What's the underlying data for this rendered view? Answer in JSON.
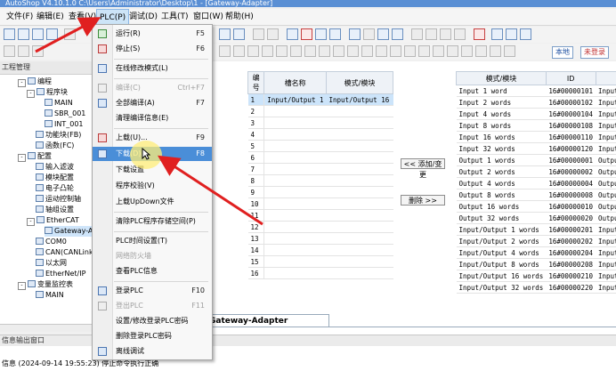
{
  "window": {
    "title": "AutoShop V4.10.1.0  C:\\Users\\Administrator\\Desktop\\1 - [Gateway-Adapter]"
  },
  "menubar": {
    "items": [
      {
        "label": "文件(F)"
      },
      {
        "label": "编辑(E)"
      },
      {
        "label": "查看(V)"
      },
      {
        "label": "PLC(P)"
      },
      {
        "label": "调试(D)"
      },
      {
        "label": "工具(T)"
      },
      {
        "label": "窗口(W)"
      },
      {
        "label": "帮助(H)"
      }
    ]
  },
  "toolbar": {
    "local_label": "本地",
    "login_status": "未登录"
  },
  "project_panel": {
    "title": "工程管理"
  },
  "tree": [
    {
      "label": "编程"
    },
    {
      "label": "程序块"
    },
    {
      "label": "MAIN"
    },
    {
      "label": "SBR_001"
    },
    {
      "label": "INT_001"
    },
    {
      "label": "功能块(FB)"
    },
    {
      "label": "函数(FC)"
    },
    {
      "label": "配置"
    },
    {
      "label": "输入滤波"
    },
    {
      "label": "模块配置"
    },
    {
      "label": "电子凸轮"
    },
    {
      "label": "运动控制轴"
    },
    {
      "label": "轴组设置"
    },
    {
      "label": "EtherCAT"
    },
    {
      "label": "Gateway-Adapter"
    },
    {
      "label": "COM0"
    },
    {
      "label": "CAN(CANLink)"
    },
    {
      "label": "以太网"
    },
    {
      "label": "EtherNet/IP"
    },
    {
      "label": "变量监控表"
    },
    {
      "label": "MAIN"
    }
  ],
  "plc_menu": {
    "items": [
      {
        "label": "运行(R)",
        "shortcut": "F5"
      },
      {
        "label": "停止(S)",
        "shortcut": "F6"
      },
      {
        "label": "在线修改模式(L)",
        "shortcut": ""
      },
      {
        "label": "编译(C)",
        "shortcut": "Ctrl+F7"
      },
      {
        "label": "全部编译(A)",
        "shortcut": "F7"
      },
      {
        "label": "清理编译信息(E)",
        "shortcut": ""
      },
      {
        "label": "上载(U)...",
        "shortcut": "F9"
      },
      {
        "label": "下载(D)...",
        "shortcut": "F8"
      },
      {
        "label": "下载设置",
        "shortcut": ""
      },
      {
        "label": "程序校验(V)",
        "shortcut": ""
      },
      {
        "label": "上载UpDown文件",
        "shortcut": ""
      },
      {
        "label": "清除PLC程序存储空间(P)",
        "shortcut": ""
      },
      {
        "label": "PLC时间设置(T)",
        "shortcut": ""
      },
      {
        "label": "网络防火墙",
        "shortcut": ""
      },
      {
        "label": "查看PLC信息",
        "shortcut": ""
      },
      {
        "label": "登录PLC",
        "shortcut": "F10"
      },
      {
        "label": "登出PLC",
        "shortcut": "F11"
      },
      {
        "label": "设置/修改登录PLC密码",
        "shortcut": ""
      },
      {
        "label": "删除登录PLC密码",
        "shortcut": ""
      },
      {
        "label": "离线调试",
        "shortcut": ""
      }
    ]
  },
  "left_table": {
    "headers": [
      "编号",
      "槽名称",
      "模式/模块"
    ],
    "rows": [
      {
        "num": "1",
        "slot": "Input/Output 1",
        "mode": "Input/Output 16"
      },
      {
        "num": "2",
        "slot": "",
        "mode": ""
      },
      {
        "num": "3",
        "slot": "",
        "mode": ""
      },
      {
        "num": "4",
        "slot": "",
        "mode": ""
      },
      {
        "num": "5",
        "slot": "",
        "mode": ""
      },
      {
        "num": "6",
        "slot": "",
        "mode": ""
      },
      {
        "num": "7",
        "slot": "",
        "mode": ""
      },
      {
        "num": "8",
        "slot": "",
        "mode": ""
      },
      {
        "num": "9",
        "slot": "",
        "mode": ""
      },
      {
        "num": "10",
        "slot": "",
        "mode": ""
      },
      {
        "num": "11",
        "slot": "",
        "mode": ""
      },
      {
        "num": "12",
        "slot": "",
        "mode": ""
      },
      {
        "num": "13",
        "slot": "",
        "mode": ""
      },
      {
        "num": "14",
        "slot": "",
        "mode": ""
      },
      {
        "num": "15",
        "slot": "",
        "mode": ""
      },
      {
        "num": "16",
        "slot": "",
        "mode": ""
      }
    ]
  },
  "buttons": {
    "add": "<< 添加/变更",
    "delete": "删除 >>"
  },
  "right_table": {
    "headers": [
      "模式/模块",
      "ID"
    ],
    "rows": [
      {
        "mode": "Input 1 word",
        "id": "16#00000101",
        "extra": "Input 1"
      },
      {
        "mode": "Input 2 words",
        "id": "16#00000102",
        "extra": "Input 2"
      },
      {
        "mode": "Input 4 words",
        "id": "16#00000104",
        "extra": "Input 4"
      },
      {
        "mode": "Input 8 words",
        "id": "16#00000108",
        "extra": "Input 8"
      },
      {
        "mode": "Input 16 words",
        "id": "16#00000110",
        "extra": "Input 16"
      },
      {
        "mode": "Input 32 words",
        "id": "16#00000120",
        "extra": "Input 32"
      },
      {
        "mode": "Output 1 words",
        "id": "16#00000001",
        "extra": "Output 1"
      },
      {
        "mode": "Output 2 words",
        "id": "16#00000002",
        "extra": "Output 2"
      },
      {
        "mode": "Output 4 words",
        "id": "16#00000004",
        "extra": "Output 4"
      },
      {
        "mode": "Output 8 words",
        "id": "16#00000008",
        "extra": "Output 8"
      },
      {
        "mode": "Output 16 words",
        "id": "16#00000010",
        "extra": "Output 16"
      },
      {
        "mode": "Output 32 words",
        "id": "16#00000020",
        "extra": "Output 32"
      },
      {
        "mode": "Input/Output 1 words",
        "id": "16#00000201",
        "extra": "Input/Ou"
      },
      {
        "mode": "Input/Output 2 words",
        "id": "16#00000202",
        "extra": "Input/Ou"
      },
      {
        "mode": "Input/Output 4 words",
        "id": "16#00000204",
        "extra": "Input/Ou"
      },
      {
        "mode": "Input/Output 8 words",
        "id": "16#00000208",
        "extra": "Input/Ou"
      },
      {
        "mode": "Input/Output 16 words",
        "id": "16#00000210",
        "extra": "Input/Ou"
      },
      {
        "mode": "Input/Output 32 words",
        "id": "16#00000220",
        "extra": "Input/Ou"
      }
    ]
  },
  "tab": {
    "label": "Gateway-Adapter"
  },
  "output": {
    "title": "信息输出窗口",
    "message": "信息  (2024-09-14 19:55:23)  停止命令执行正确"
  },
  "colors": {
    "accent": "#4a8ed8",
    "arrow": "#e02020"
  }
}
